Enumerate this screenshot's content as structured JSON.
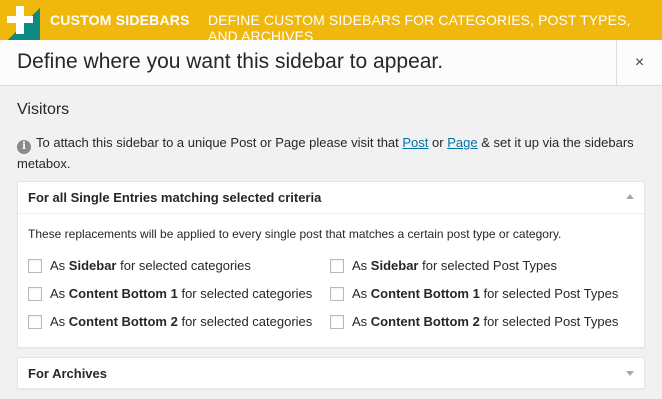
{
  "banner": {
    "title": "CUSTOM SIDEBARS",
    "subtitle": "DEFINE CUSTOM SIDEBARS FOR CATEGORIES, POST TYPES, AND ARCHIVES",
    "colors": {
      "background": "#f0b80c",
      "accent": "#0e8a82"
    }
  },
  "modal": {
    "title": "Define where you want this sidebar to appear.",
    "close_label": "×"
  },
  "visitors": {
    "heading": "Visitors",
    "info_icon_glyph": "i",
    "info_pre": "To attach this sidebar to a unique Post or Page please visit that ",
    "info_post_link": "Post",
    "info_or": " or ",
    "info_page_link": "Page",
    "info_post": " & set it up via the sidebars metabox."
  },
  "panels": [
    {
      "title": "For all Single Entries matching selected criteria",
      "expanded": true,
      "description": "These replacements will be applied to every single post that matches a certain post type or category.",
      "options": [
        {
          "prefix": "As ",
          "bold": "Sidebar",
          "suffix": " for selected categories",
          "checked": false
        },
        {
          "prefix": "As ",
          "bold": "Sidebar",
          "suffix": " for selected Post Types",
          "checked": false
        },
        {
          "prefix": "As ",
          "bold": "Content Bottom 1",
          "suffix": " for selected categories",
          "checked": false
        },
        {
          "prefix": "As ",
          "bold": "Content Bottom 1",
          "suffix": " for selected Post Types",
          "checked": false
        },
        {
          "prefix": "As ",
          "bold": "Content Bottom 2",
          "suffix": " for selected categories",
          "checked": false
        },
        {
          "prefix": "As ",
          "bold": "Content Bottom 2",
          "suffix": " for selected Post Types",
          "checked": false
        }
      ]
    },
    {
      "title": "For Archives",
      "expanded": false
    }
  ]
}
